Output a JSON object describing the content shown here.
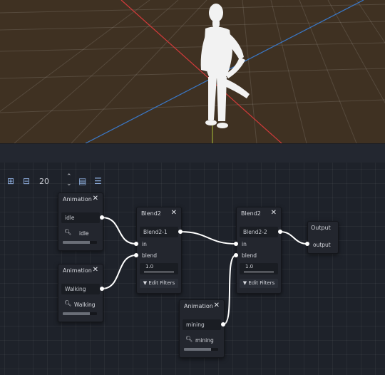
{
  "toolbar": {
    "zoom_out_icon": "zoom-out-grid-icon",
    "zoom_reset_icon": "zoom-reset-grid-icon",
    "snap_value": "20",
    "spinner_icon": "spinner-up-down-icon",
    "minimap_icon": "minimap-icon",
    "arrange_icon": "arrange-nodes-icon"
  },
  "nodes": {
    "anim_idle": {
      "title": "Animation",
      "name": "idle",
      "play_label": "idle",
      "progress": 0.8
    },
    "anim_walking": {
      "title": "Animation",
      "name": "Walking",
      "play_label": "Walking",
      "progress": 0.8
    },
    "anim_mining": {
      "title": "Animation",
      "name": "mining",
      "play_label": "mining",
      "progress": 0.8
    },
    "blend1": {
      "title": "Blend2",
      "name": "Blend2-1",
      "in_label": "in",
      "blend_label": "blend",
      "amount": "1.0",
      "filters_label": "Edit Filters"
    },
    "blend2": {
      "title": "Blend2",
      "name": "Blend2-2",
      "in_label": "in",
      "blend_label": "blend",
      "amount": "1.0",
      "filters_label": "Edit Filters"
    },
    "output": {
      "title": "Output",
      "port_label": "output"
    }
  },
  "close_glyph": "✕",
  "colors": {
    "floor": "#3f3122",
    "x_axis": "#d23a3a",
    "z_axis": "#3a78c8",
    "graph_bg": "#1e222a",
    "node_bg": "#23262e",
    "wire": "#ffffff"
  }
}
